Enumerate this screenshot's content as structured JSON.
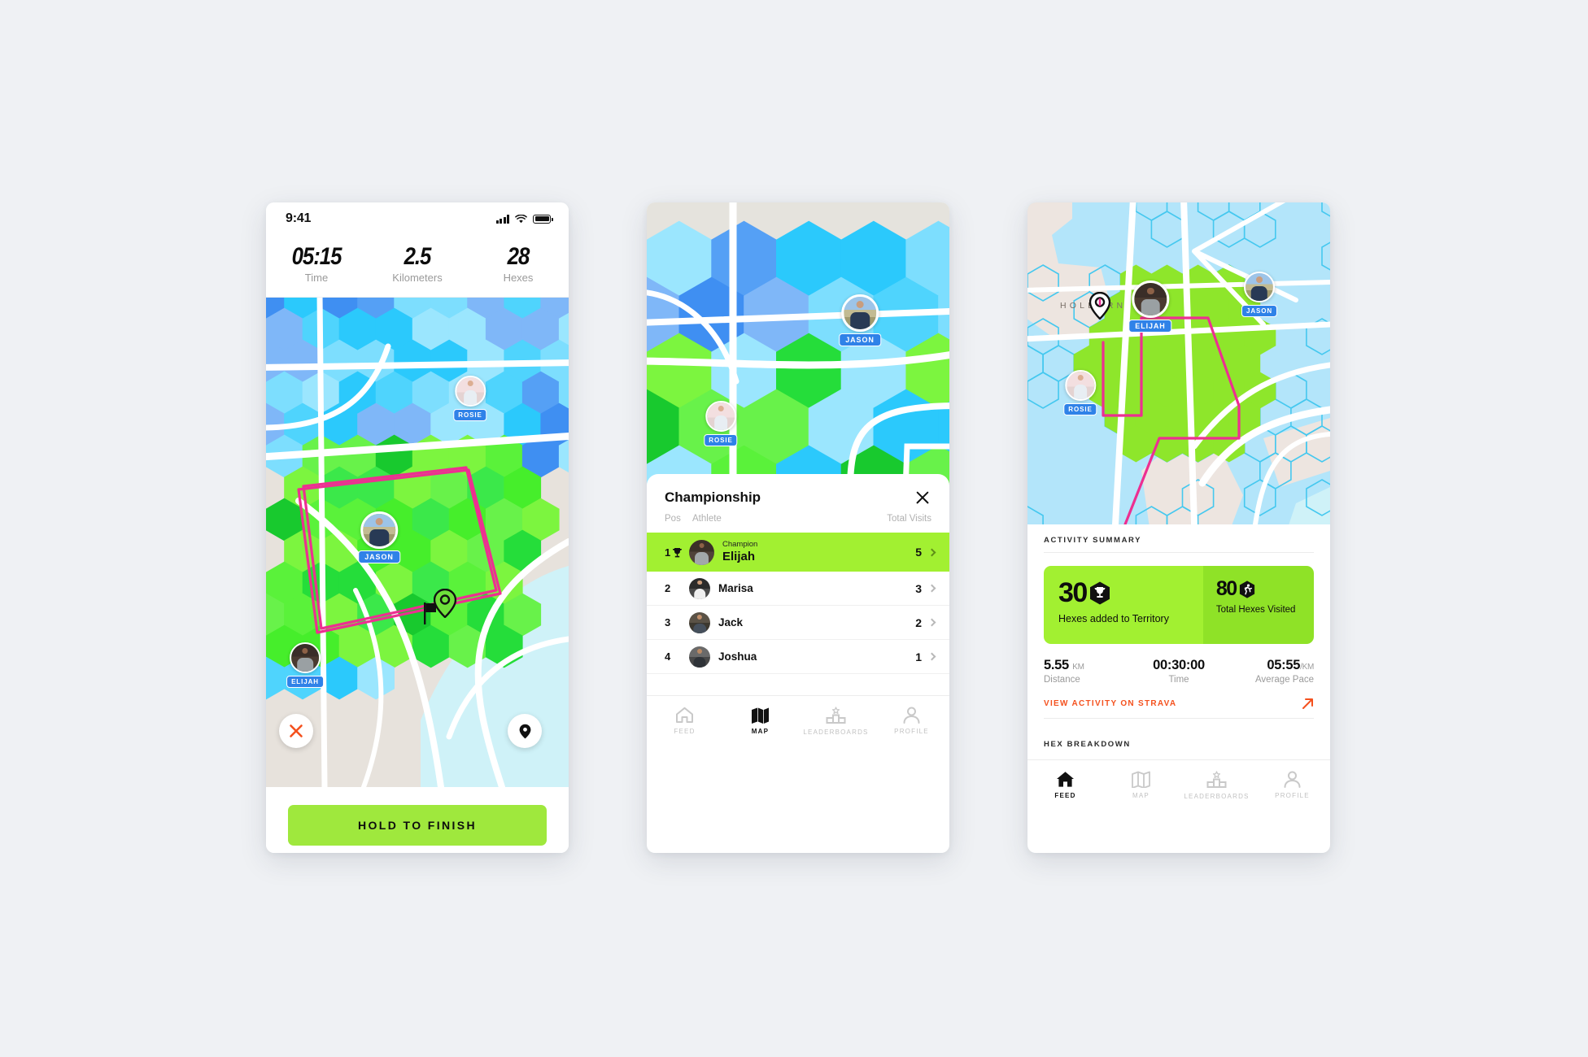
{
  "colors": {
    "page_bg": "#EFF1F4",
    "accent_green": "#A2F031",
    "button_green": "#9FE83D",
    "card_green_dark": "#8FE227",
    "badge_blue": "#2F82E8",
    "route_pink": "#ED2F91",
    "strava_orange": "#F4511E",
    "hex_cyan": "#2BC9FC",
    "hex_blue": "#55A0F5",
    "hex_green": "#25DD3A",
    "map_beige": "#E5E3DD",
    "map_lightblue": "#B3E5FA"
  },
  "phone1": {
    "status": {
      "time": "9:41",
      "signal_icon": "cellular-bars-icon",
      "wifi_icon": "wifi-icon",
      "battery_icon": "battery-icon"
    },
    "stats": [
      {
        "value": "05:15",
        "label": "Time"
      },
      {
        "value": "2.5",
        "label": "Kilometers"
      },
      {
        "value": "28",
        "label": "Hexes"
      }
    ],
    "map": {
      "pins": [
        {
          "name": "ROSIE",
          "avatar": "rosie"
        },
        {
          "name": "JASON",
          "avatar": "jason"
        },
        {
          "name": "ELIJAH",
          "avatar": "elijah"
        }
      ],
      "close_icon": "close-x-icon",
      "locate_icon": "location-pin-icon",
      "finish_flag_icon": "finish-flag-icon",
      "current_position_icon": "current-position-pin-icon"
    },
    "finish_button": "HOLD TO FINISH"
  },
  "phone2": {
    "map": {
      "pins": [
        {
          "name": "JASON",
          "avatar": "jason"
        },
        {
          "name": "ROSIE",
          "avatar": "rosie"
        }
      ]
    },
    "sheet": {
      "title": "Championship",
      "close_icon": "close-x-icon",
      "columns": {
        "pos": "Pos",
        "athlete": "Athlete",
        "total_visits": "Total Visits"
      },
      "rows": [
        {
          "pos": "1",
          "sub": "Champion",
          "name": "Elijah",
          "visits": "5",
          "avatar": "champion",
          "trophy": true,
          "highlight": true
        },
        {
          "pos": "2",
          "sub": "",
          "name": "Marisa",
          "visits": "3",
          "avatar": "marisa",
          "trophy": false,
          "highlight": false
        },
        {
          "pos": "3",
          "sub": "",
          "name": "Jack",
          "visits": "2",
          "avatar": "jack",
          "trophy": false,
          "highlight": false
        },
        {
          "pos": "4",
          "sub": "",
          "name": "Joshua",
          "visits": "1",
          "avatar": "joshua",
          "trophy": false,
          "highlight": false
        }
      ]
    },
    "tabs": [
      {
        "label": "FEED",
        "icon": "home-icon",
        "active": false
      },
      {
        "label": "MAP",
        "icon": "map-icon",
        "active": true
      },
      {
        "label": "LEADERBOARDS",
        "icon": "podium-star-icon",
        "active": false
      },
      {
        "label": "PROFILE",
        "icon": "person-icon",
        "active": false
      }
    ]
  },
  "phone3": {
    "map": {
      "area_label": "HOLBORN",
      "pins": [
        {
          "name": "ELIJAH",
          "avatar": "elijah"
        },
        {
          "name": "JASON",
          "avatar": "jason"
        },
        {
          "name": "ROSIE",
          "avatar": "rosie"
        }
      ],
      "start_icon": "start-position-pin-icon"
    },
    "summary": {
      "heading": "ACTIVITY SUMMARY",
      "card_primary": {
        "value": "30",
        "icon": "hex-trophy-icon",
        "label": "Hexes added to Territory"
      },
      "card_secondary": {
        "value": "80",
        "icon": "hex-runner-icon",
        "label": "Total Hexes Visited"
      },
      "stats": [
        {
          "value": "5.55",
          "unit": "KM",
          "label": "Distance"
        },
        {
          "value": "00:30:00",
          "unit": "",
          "label": "Time"
        },
        {
          "value": "05:55",
          "unit": "/KM",
          "label": "Average Pace"
        }
      ],
      "strava_link": "VIEW ACTIVITY ON STRAVA",
      "strava_icon": "arrow-northeast-icon",
      "hex_breakdown_heading": "HEX BREAKDOWN"
    },
    "tabs": [
      {
        "label": "FEED",
        "icon": "home-icon",
        "active": true
      },
      {
        "label": "MAP",
        "icon": "map-icon",
        "active": false
      },
      {
        "label": "LEADERBOARDS",
        "icon": "podium-star-icon",
        "active": false
      },
      {
        "label": "PROFILE",
        "icon": "person-icon",
        "active": false
      }
    ]
  }
}
